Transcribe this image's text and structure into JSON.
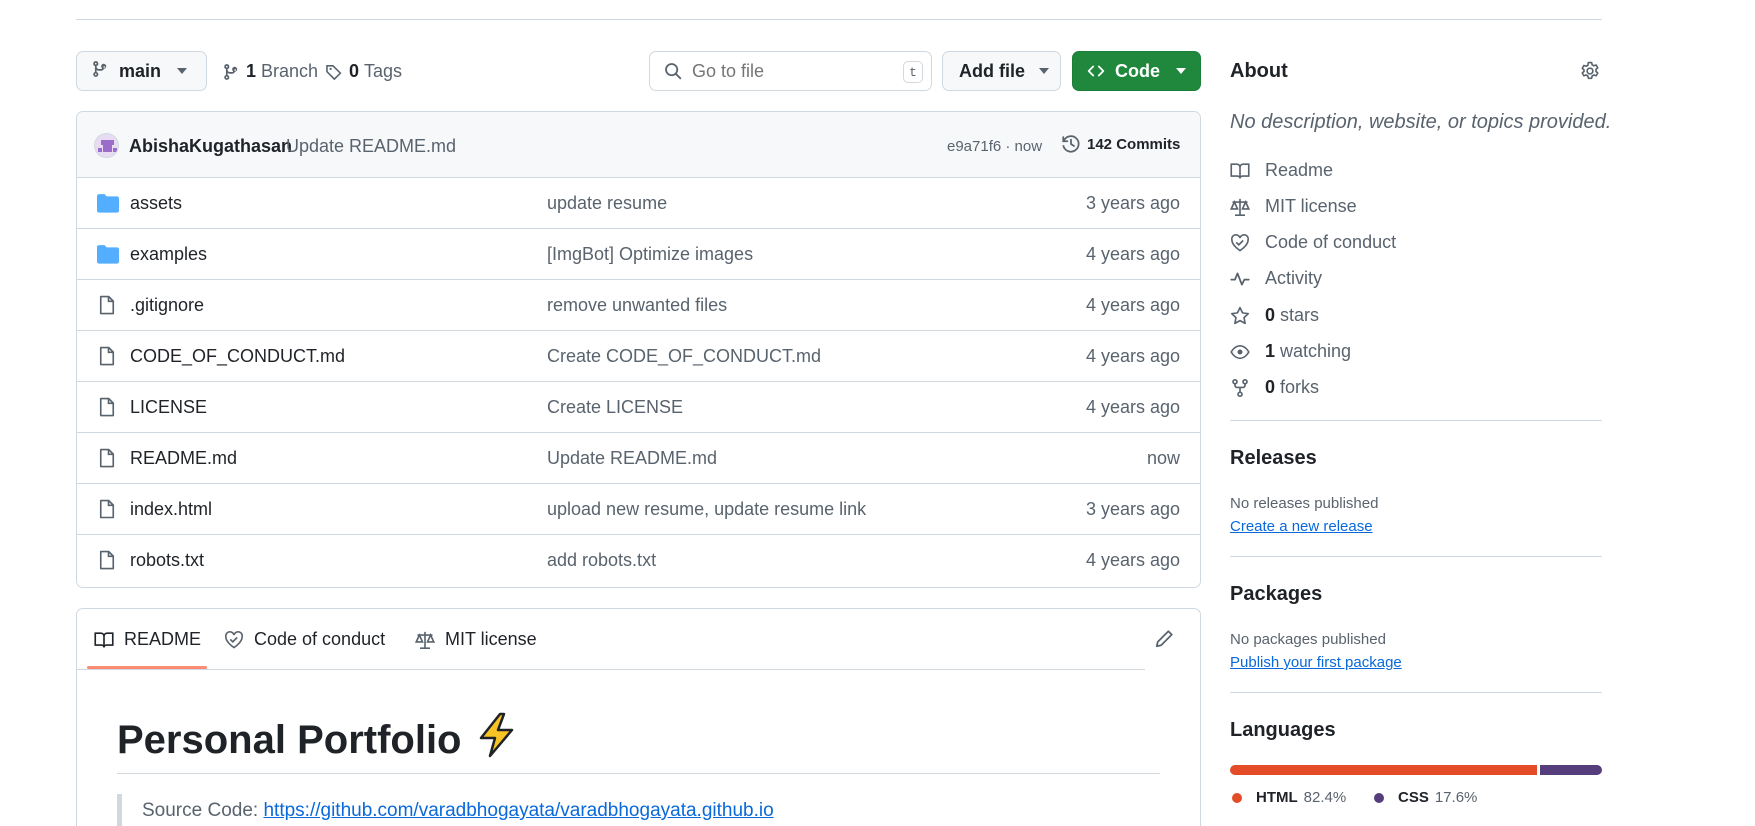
{
  "toolbar": {
    "branch_label": "main",
    "branches_count": "1",
    "branches_label": "Branch",
    "tags_count": "0",
    "tags_label": "Tags",
    "search_placeholder": "Go to file",
    "search_shortcut": "t",
    "add_file_label": "Add file",
    "code_label": "Code"
  },
  "commit": {
    "author": "AbishaKugathasan",
    "message": "Update README.md",
    "hash_time": "e9a71f6 · now",
    "commits_count": "142 Commits"
  },
  "files": [
    {
      "type": "folder",
      "name": "assets",
      "message": "update resume",
      "age": "3 years ago"
    },
    {
      "type": "folder",
      "name": "examples",
      "message": "[ImgBot] Optimize images",
      "age": "4 years ago"
    },
    {
      "type": "file",
      "name": ".gitignore",
      "message": "remove unwanted files",
      "age": "4 years ago"
    },
    {
      "type": "file",
      "name": "CODE_OF_CONDUCT.md",
      "message": "Create CODE_OF_CONDUCT.md",
      "age": "4 years ago"
    },
    {
      "type": "file",
      "name": "LICENSE",
      "message": "Create LICENSE",
      "age": "4 years ago"
    },
    {
      "type": "file",
      "name": "README.md",
      "message": "Update README.md",
      "age": "now"
    },
    {
      "type": "file",
      "name": "index.html",
      "message": "upload new resume, update resume link",
      "age": "3 years ago"
    },
    {
      "type": "file",
      "name": "robots.txt",
      "message": "add robots.txt",
      "age": "4 years ago"
    }
  ],
  "readme": {
    "tabs": [
      "README",
      "Code of conduct",
      "MIT license"
    ],
    "title": "Personal Portfolio",
    "title_emoji": "⚡",
    "source_label": "Source Code: ",
    "source_link": "https://github.com/varadbhogayata/varadbhogayata.github.io"
  },
  "about": {
    "heading": "About",
    "description": "No description, website, or topics provided.",
    "readme": "Readme",
    "license": "MIT license",
    "conduct": "Code of conduct",
    "activity": "Activity",
    "stars_count": "0",
    "stars_label": "stars",
    "watching_count": "1",
    "watching_label": "watching",
    "forks_count": "0",
    "forks_label": "forks"
  },
  "releases": {
    "heading": "Releases",
    "empty": "No releases published",
    "link": "Create a new release"
  },
  "packages": {
    "heading": "Packages",
    "empty": "No packages published",
    "link": "Publish your first package"
  },
  "languages": {
    "heading": "Languages",
    "items": [
      {
        "name": "HTML",
        "percent": "82.4%",
        "color": "#e34c26"
      },
      {
        "name": "CSS",
        "percent": "17.6%",
        "color": "#563d7c"
      }
    ]
  },
  "colors": {
    "primary_button": "#1f883d",
    "link": "#0969da",
    "folder": "#54aeff",
    "tab_underline": "#fd8c73"
  }
}
